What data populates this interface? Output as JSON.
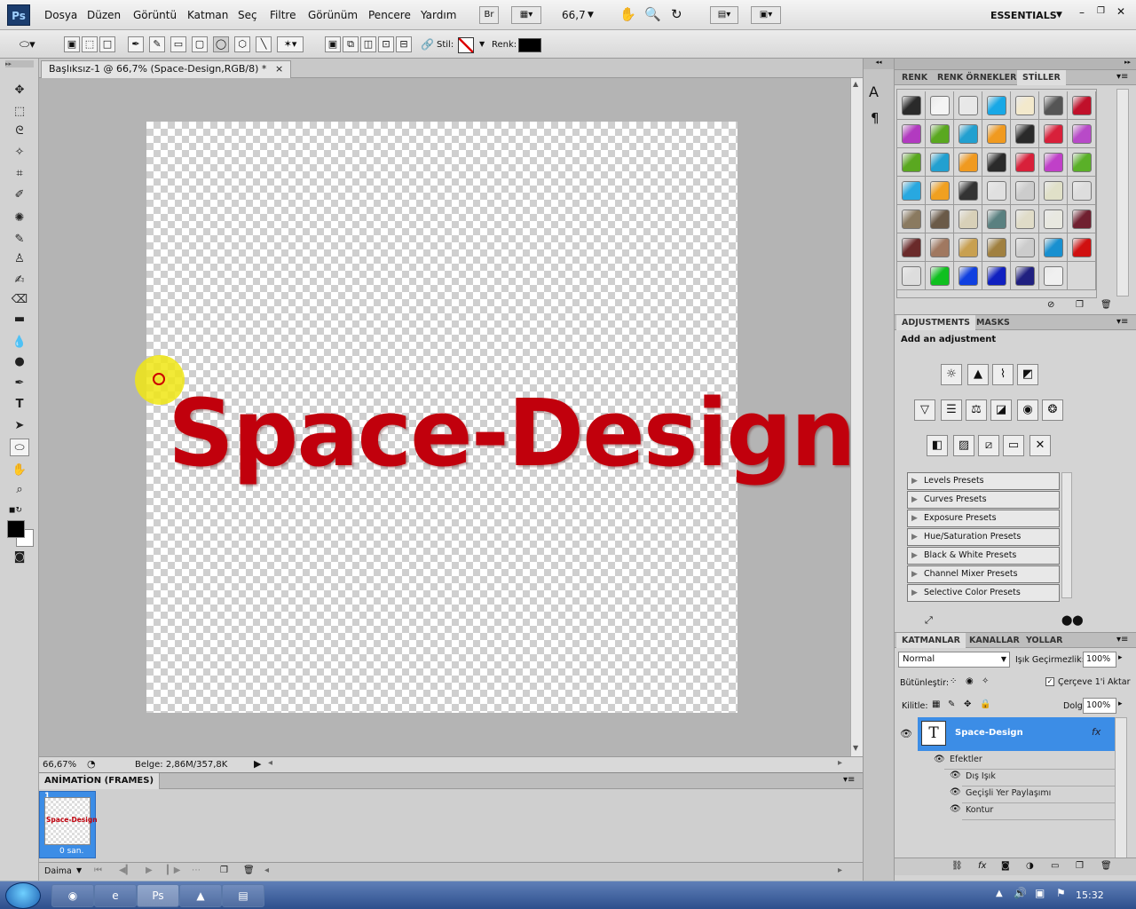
{
  "app": {
    "logo": "Ps",
    "menu": [
      "Dosya",
      "Düzen",
      "Görüntü",
      "Katman",
      "Seç",
      "Filtre",
      "Görünüm",
      "Pencere",
      "Yardım"
    ],
    "bridge": "Br",
    "zoom_value": "66,7",
    "workspace": "ESSENTIALS"
  },
  "options": {
    "style_label": "Stil:",
    "color_label": "Renk:",
    "color_value": "#000000"
  },
  "document": {
    "tab_title": "Başlıksız-1 @ 66,7% (Space-Design,RGB/8) *",
    "close": "×",
    "canvas_text": "Space-Design",
    "text_color": "#c1000c"
  },
  "status": {
    "zoom": "66,67%",
    "doc_size": "Belge: 2,86M/357,8K"
  },
  "animation": {
    "tab": "ANİMATİON (FRAMES)",
    "frame_number": "1",
    "frame_thumb_text": "Space-Design",
    "frame_delay": "0 san.",
    "loop": "Daima"
  },
  "styles_panel": {
    "tabs": [
      "RENK",
      "RENK ÖRNEKLERİ",
      "STİLLER"
    ],
    "active_tab": "STİLLER",
    "swatch_rows": [
      [
        "#2a2a2a",
        "#f4f4f4",
        "#e8e8e8",
        "#18a8e6",
        "#f3e9cc",
        "#555555",
        "#c0102a"
      ],
      [
        "#b23ac0",
        "#5aa820",
        "#22a0d0",
        "#f09a20",
        "#2a2a2a",
        "#d8203a",
        "#b84ac8"
      ],
      [
        "#5aa820",
        "#22a0d0",
        "#f09a20",
        "#2a2a2a",
        "#d8203a",
        "#c040c8",
        "#5ab028"
      ],
      [
        "#28a8e0",
        "#f0a020",
        "#333333",
        "#e0e0e0",
        "#cccccc",
        "#e0e0c8",
        "#dddddd"
      ],
      [
        "#8a7a60",
        "#6a5a48",
        "#d8d0b8",
        "#5a8080",
        "#e0dcc8",
        "#e8e8e0",
        "#702030"
      ],
      [
        "#6a2a2a",
        "#a07860",
        "#c8a050",
        "#a08040",
        "#cccccc",
        "#1890d0",
        "#d01010"
      ],
      [
        "#dddddd",
        "#10c020",
        "#1040e0",
        "#1020c0",
        "#202080",
        "#f0f0f0",
        ""
      ]
    ]
  },
  "adjustments": {
    "tabs": [
      "ADJUSTMENTS",
      "MASKS"
    ],
    "heading": "Add an adjustment",
    "presets": [
      "Levels Presets",
      "Curves Presets",
      "Exposure Presets",
      "Hue/Saturation Presets",
      "Black & White Presets",
      "Channel Mixer Presets",
      "Selective Color Presets"
    ]
  },
  "layers": {
    "tabs": [
      "KATMANLAR",
      "KANALLAR",
      "YOLLAR"
    ],
    "blend_mode": "Normal",
    "opacity_label": "Işık Geçirmezlik:",
    "opacity": "100%",
    "unify_label": "Bütünleştir:",
    "propagate_label": "Çerçeve 1'i Aktar",
    "lock_label": "Kilitle:",
    "fill_label": "Dolgu:",
    "fill": "100%",
    "layer_name": "Space-Design",
    "fx": "fx",
    "effects_label": "Efektler",
    "effects": [
      "Dış Işık",
      "Geçişli Yer Paylaşımı",
      "Kontur"
    ]
  },
  "taskbar": {
    "clock": "15:32",
    "apps": [
      "chrome-icon",
      "ie-icon",
      "photoshop-icon",
      "picture-icon",
      "notepad-icon"
    ],
    "ps_label": "Ps"
  }
}
